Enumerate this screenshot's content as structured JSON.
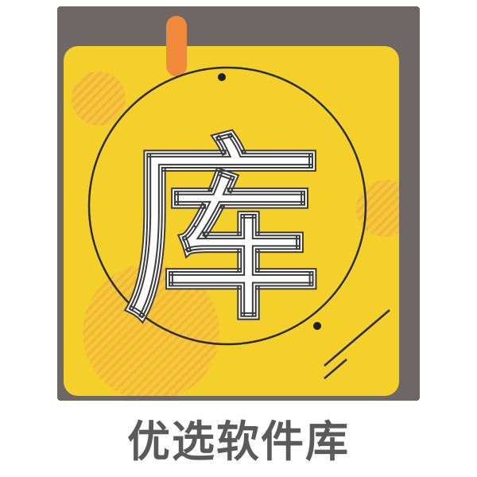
{
  "app": {
    "icon_glyph": "库",
    "name": "优选软件库"
  },
  "colors": {
    "tile_background": "#6d6866",
    "card_yellow": "#f5d02a",
    "deco_dots": "#f0b93c",
    "pin_orange": "#f08a3a",
    "glyph_white": "#ffffff",
    "line_dark": "#2b2b2b",
    "name_text": "#5a5a5a"
  },
  "icons": {
    "main": "library-icon",
    "pin": "pin-icon"
  }
}
